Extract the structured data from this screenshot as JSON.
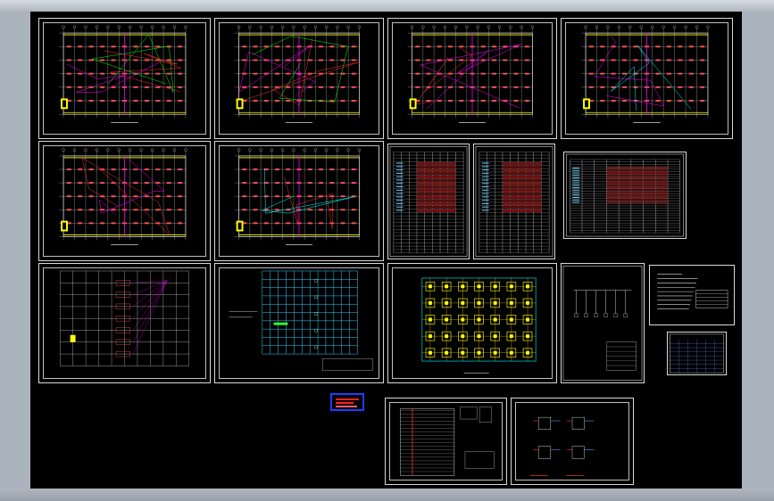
{
  "viewer": {
    "background": "#000000",
    "frame_color": "#aab3bd"
  },
  "sheets": [
    {
      "id": "floor-plan-1",
      "kind": "plan",
      "wiring": [
        "#ff3030",
        "#00ff00",
        "#ff00ff"
      ],
      "title": ""
    },
    {
      "id": "floor-plan-2",
      "kind": "plan",
      "wiring": [
        "#ff3030",
        "#ff00ff",
        "#00ff00"
      ],
      "title": ""
    },
    {
      "id": "floor-plan-3",
      "kind": "plan",
      "wiring": [
        "#ff00ff",
        "#ff3030"
      ],
      "title": ""
    },
    {
      "id": "floor-plan-4",
      "kind": "plan",
      "wiring": [
        "#ff00ff",
        "#00ffff"
      ],
      "title": ""
    },
    {
      "id": "floor-plan-5",
      "kind": "plan",
      "wiring": [
        "#ff3030",
        "#ff00ff"
      ],
      "title": ""
    },
    {
      "id": "floor-plan-6",
      "kind": "plan",
      "wiring": [
        "#ff3030",
        "#00ffff"
      ],
      "title": ""
    },
    {
      "id": "schedule-table-1",
      "kind": "table",
      "title": ""
    },
    {
      "id": "schedule-table-2",
      "kind": "table",
      "title": ""
    },
    {
      "id": "schedule-table-3",
      "kind": "table",
      "title": ""
    },
    {
      "id": "riser-diagram",
      "kind": "riser",
      "title": ""
    },
    {
      "id": "grid-plan-cyan",
      "kind": "grid",
      "title": ""
    },
    {
      "id": "column-layout",
      "kind": "columns",
      "title": ""
    },
    {
      "id": "system-diagram",
      "kind": "diagram",
      "title": ""
    },
    {
      "id": "design-notes",
      "kind": "notes",
      "title": ""
    },
    {
      "id": "small-table",
      "kind": "smalltable",
      "title": ""
    },
    {
      "id": "panel-schedule",
      "kind": "panel",
      "title": ""
    },
    {
      "id": "connection-detail",
      "kind": "detail",
      "title": ""
    }
  ]
}
